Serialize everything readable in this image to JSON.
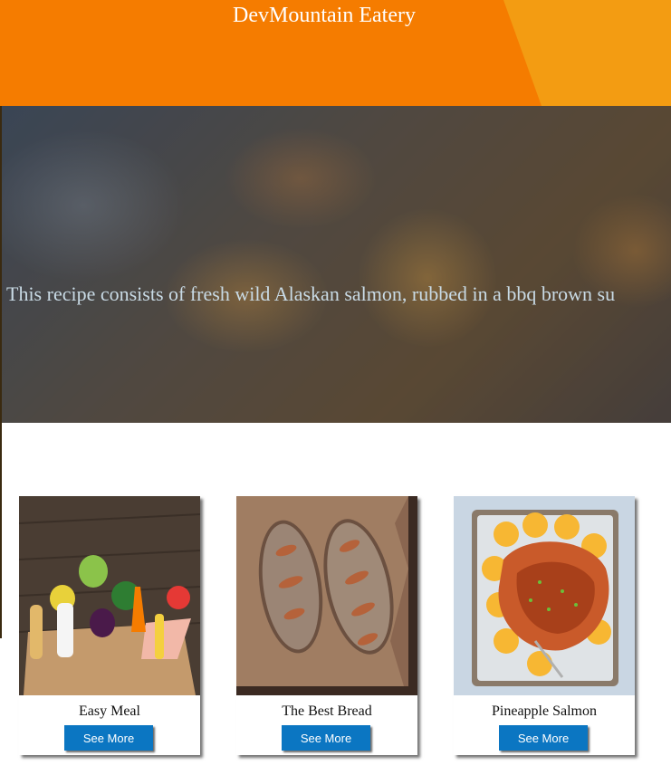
{
  "header": {
    "title": "DevMountain Eatery"
  },
  "hero": {
    "text": "This recipe consists of fresh wild Alaskan salmon, rubbed in a bbq brown su"
  },
  "cards": [
    {
      "title": "Easy Meal",
      "button": "See More",
      "image": "grocery-bag-image"
    },
    {
      "title": "The Best Bread",
      "button": "See More",
      "image": "bread-loaves-image"
    },
    {
      "title": "Pineapple Salmon",
      "button": "See More",
      "image": "salmon-tray-image"
    }
  ],
  "colors": {
    "header_dark": "#f57c00",
    "header_light": "#f39c12",
    "button": "#0b76c2"
  }
}
